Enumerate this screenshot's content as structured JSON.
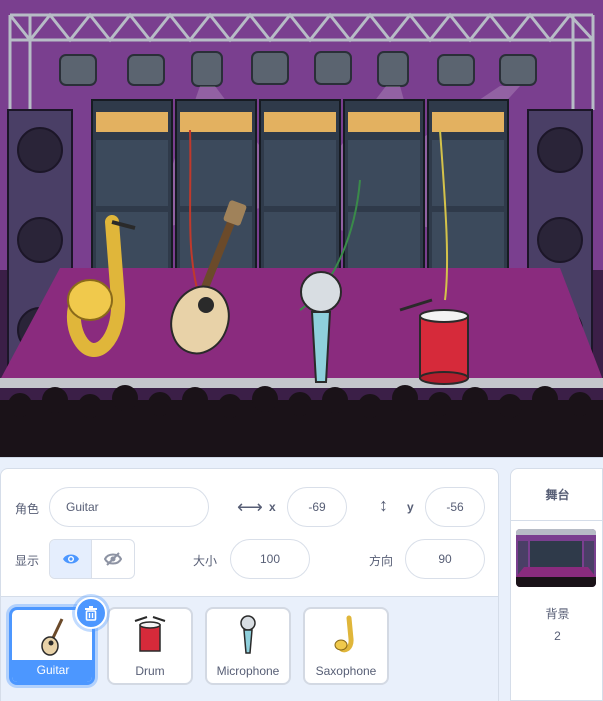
{
  "sprite_info": {
    "sprite_label": "角色",
    "sprite_name": "Guitar",
    "x_label": "x",
    "x_value": "-69",
    "y_label": "y",
    "y_value": "-56",
    "show_label": "显示",
    "size_label": "大小",
    "size_value": "100",
    "direction_label": "方向",
    "direction_value": "90"
  },
  "sprites": [
    {
      "name": "Guitar",
      "selected": true
    },
    {
      "name": "Drum",
      "selected": false
    },
    {
      "name": "Microphone",
      "selected": false
    },
    {
      "name": "Saxophone",
      "selected": false
    }
  ],
  "stage_panel": {
    "title": "舞台",
    "backdrops_label": "背景",
    "backdrops_count": "2"
  },
  "colors": {
    "accent": "#4c97ff",
    "text": "#575e75",
    "stage_floor": "#8a2b7e",
    "backdrop_purple": "#7a3f8f"
  }
}
